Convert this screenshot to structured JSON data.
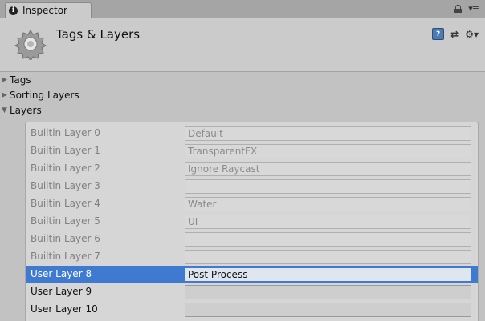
{
  "tab": {
    "label": "Inspector",
    "icon": "info-icon"
  },
  "tab_right_icons": [
    "lock-icon",
    "menu-icon"
  ],
  "header": {
    "title": "Tags & Layers",
    "icons": [
      "help-icon",
      "preset-icon",
      "settings-icon"
    ]
  },
  "foldouts": [
    {
      "label": "Tags",
      "expanded": false
    },
    {
      "label": "Sorting Layers",
      "expanded": false
    },
    {
      "label": "Layers",
      "expanded": true
    }
  ],
  "layers": [
    {
      "label": "Builtin Layer 0",
      "value": "Default",
      "builtin": true
    },
    {
      "label": "Builtin Layer 1",
      "value": "TransparentFX",
      "builtin": true
    },
    {
      "label": "Builtin Layer 2",
      "value": "Ignore Raycast",
      "builtin": true
    },
    {
      "label": "Builtin Layer 3",
      "value": "",
      "builtin": true
    },
    {
      "label": "Builtin Layer 4",
      "value": "Water",
      "builtin": true
    },
    {
      "label": "Builtin Layer 5",
      "value": "UI",
      "builtin": true
    },
    {
      "label": "Builtin Layer 6",
      "value": "",
      "builtin": true
    },
    {
      "label": "Builtin Layer 7",
      "value": "",
      "builtin": true
    },
    {
      "label": "User Layer 8",
      "value": "Post Process",
      "builtin": false,
      "selected": true
    },
    {
      "label": "User Layer 9",
      "value": "",
      "builtin": false
    },
    {
      "label": "User Layer 10",
      "value": "",
      "builtin": false
    }
  ],
  "colors": {
    "selection": "#3e7ad0",
    "panel": "#c2c2c2"
  }
}
